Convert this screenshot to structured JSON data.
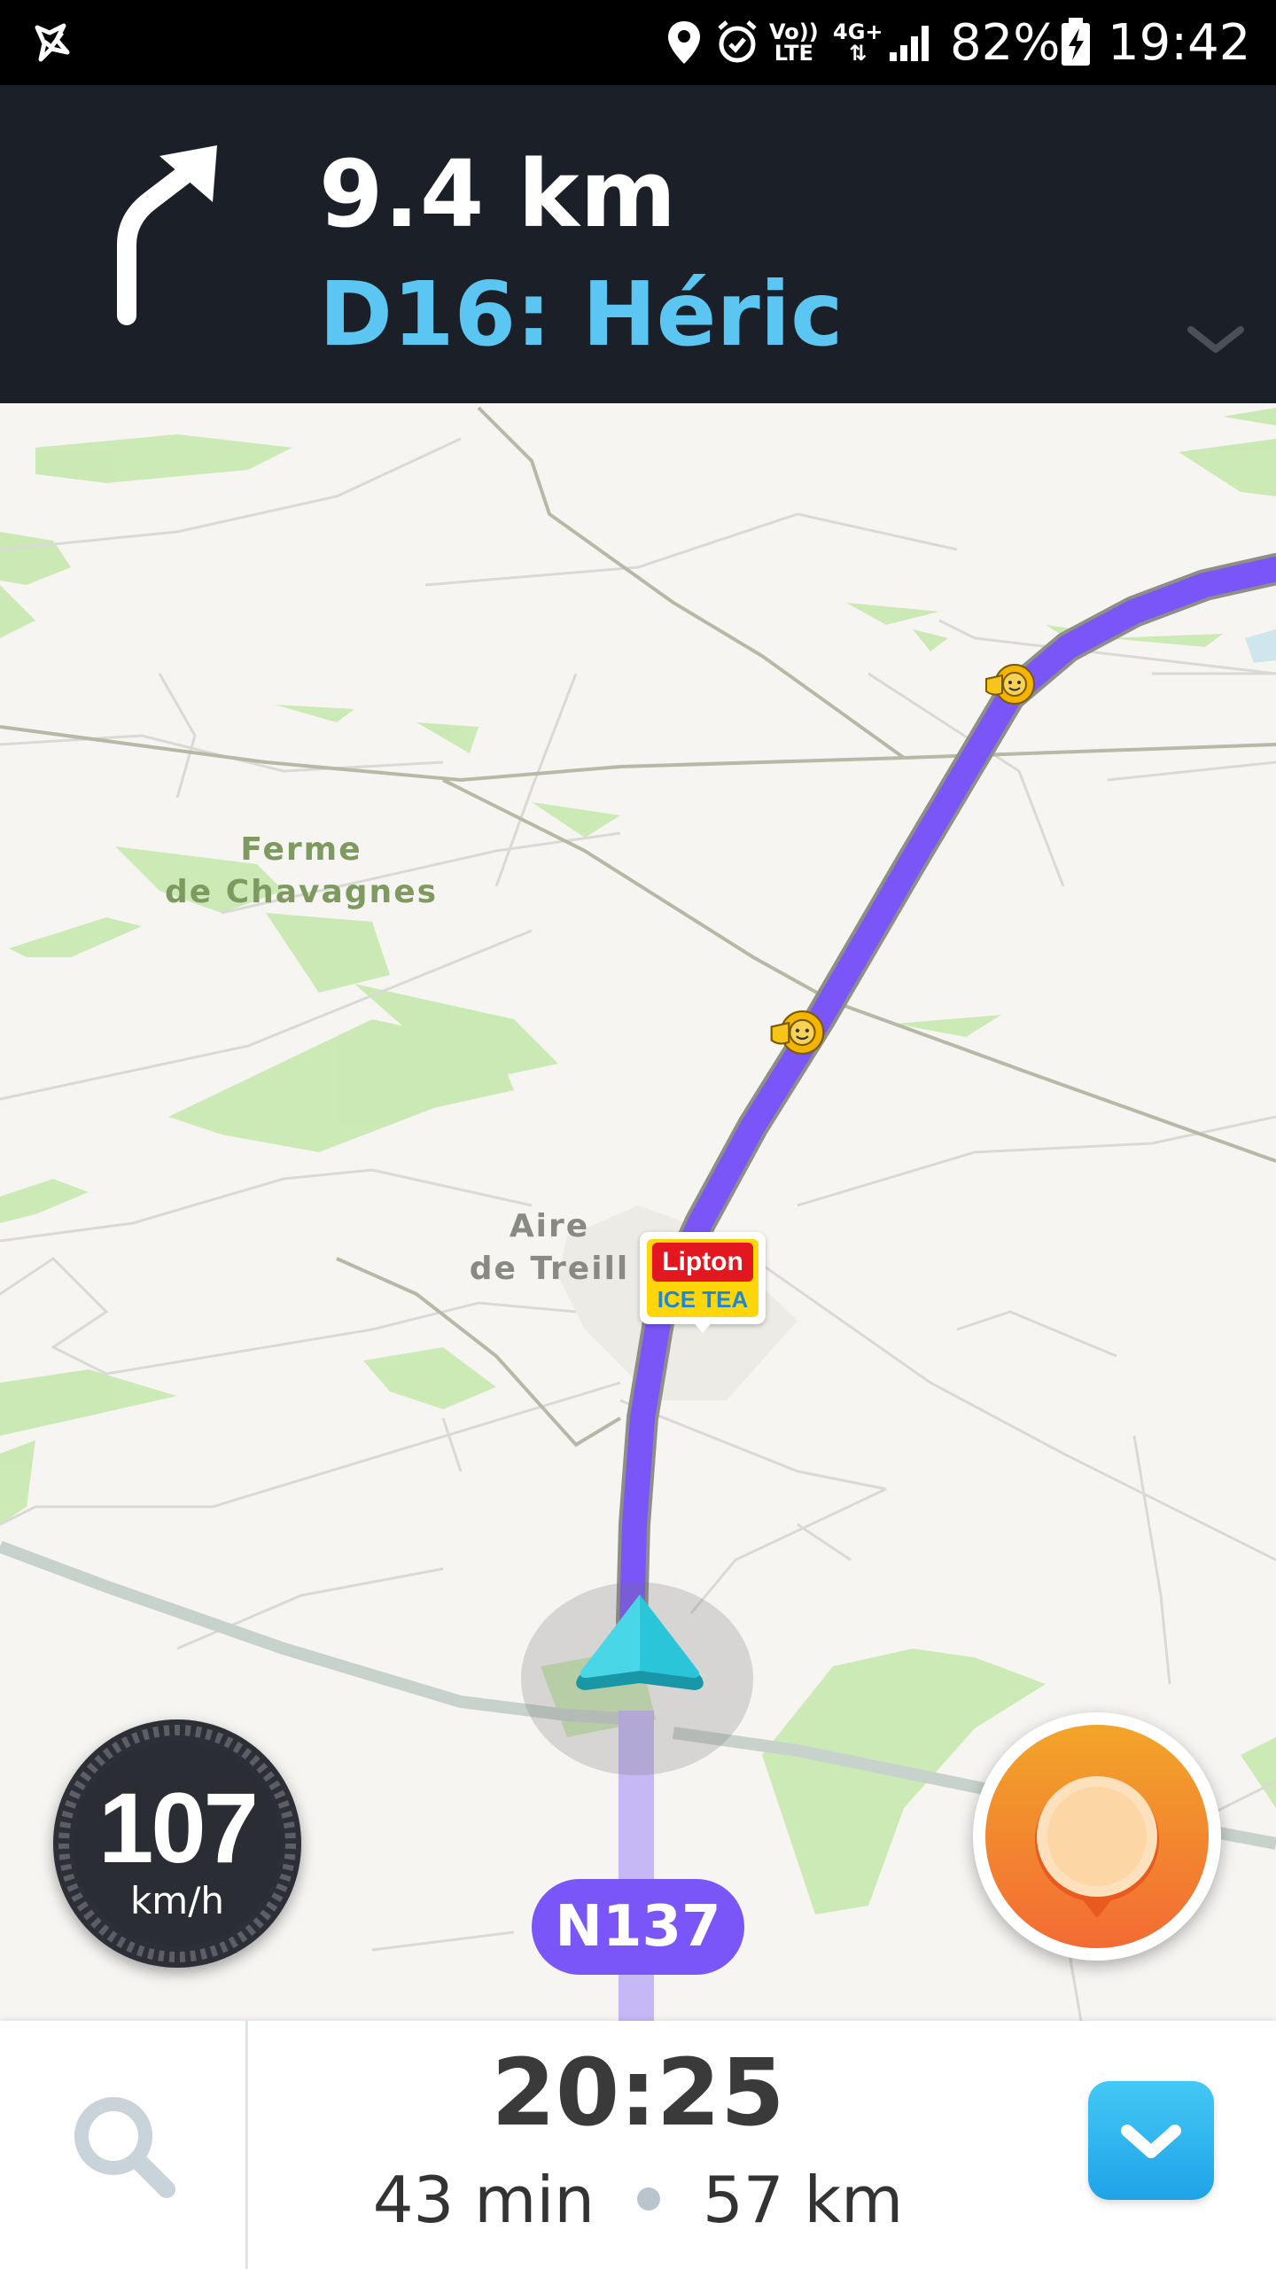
{
  "status_bar": {
    "battery_percent": "82%",
    "time": "19:42",
    "volte_line1": "Vo))",
    "volte_line2": "LTE",
    "network": "4G+",
    "icons": [
      "waze-check-icon",
      "location-pin-icon",
      "alarm-icon",
      "volte-icon",
      "network-4g-icon",
      "signal-bars-icon",
      "battery-charging-icon"
    ]
  },
  "navigation": {
    "distance": "9.4 km",
    "street": "D16: Héric",
    "turn_icon": "turn-right-arrow-icon"
  },
  "map": {
    "places": [
      {
        "line1": "Ferme",
        "line2": "de Chavagnes"
      },
      {
        "line1": "Aire",
        "line2": "de Treill"
      }
    ],
    "ad": {
      "brand": "Lipton",
      "product": "ICE TEA"
    },
    "road_name": "N137"
  },
  "speedometer": {
    "speed": "107",
    "unit": "km/h"
  },
  "bottom_bar": {
    "eta_time": "20:25",
    "duration": "43 min",
    "distance": "57 km"
  },
  "colors": {
    "route": "#7a55f7",
    "banner_bg": "#1b1f27",
    "street_text": "#5cc6f2",
    "vehicle_arrow": "#29c4d7",
    "report_orange": "#f47b30",
    "collapse_blue": "#1fa3e8"
  }
}
